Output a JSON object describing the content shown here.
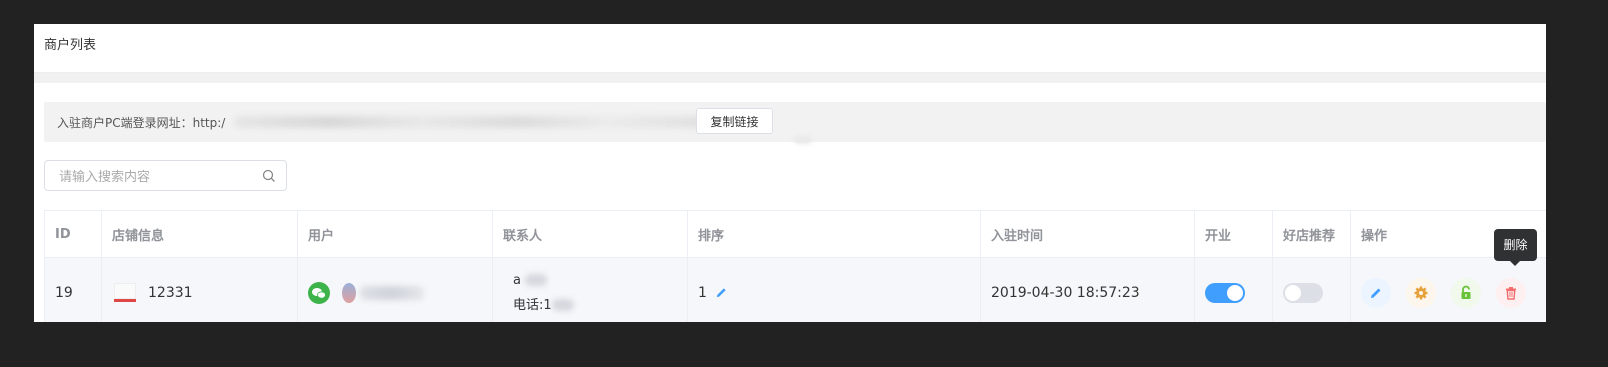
{
  "panel": {
    "title": "商户列表"
  },
  "login_bar": {
    "label": "入驻商户PC端登录网址：http:/",
    "copy_button": "复制链接"
  },
  "search": {
    "placeholder": "请输入搜索内容",
    "icon": "search-icon"
  },
  "table": {
    "columns": [
      "ID",
      "店铺信息",
      "用户",
      "联系人",
      "排序",
      "入驻时间",
      "开业",
      "好店推荐",
      "操作"
    ],
    "rows": [
      {
        "id": "19",
        "shop_name": "12331",
        "user_icon": "wechat-icon",
        "contact_name": "a",
        "contact_phone": "电话:1",
        "sort": "1",
        "join_time": "2019-04-30 18:57:23",
        "open": true,
        "recommended": false,
        "actions": [
          "edit-icon",
          "settings-icon",
          "unlock-icon",
          "delete-icon"
        ]
      }
    ]
  },
  "tooltip": {
    "text": "删除"
  },
  "colors": {
    "primary": "#409eff",
    "warning": "#e6a23c",
    "success": "#67c23a",
    "danger": "#f56c6c"
  }
}
